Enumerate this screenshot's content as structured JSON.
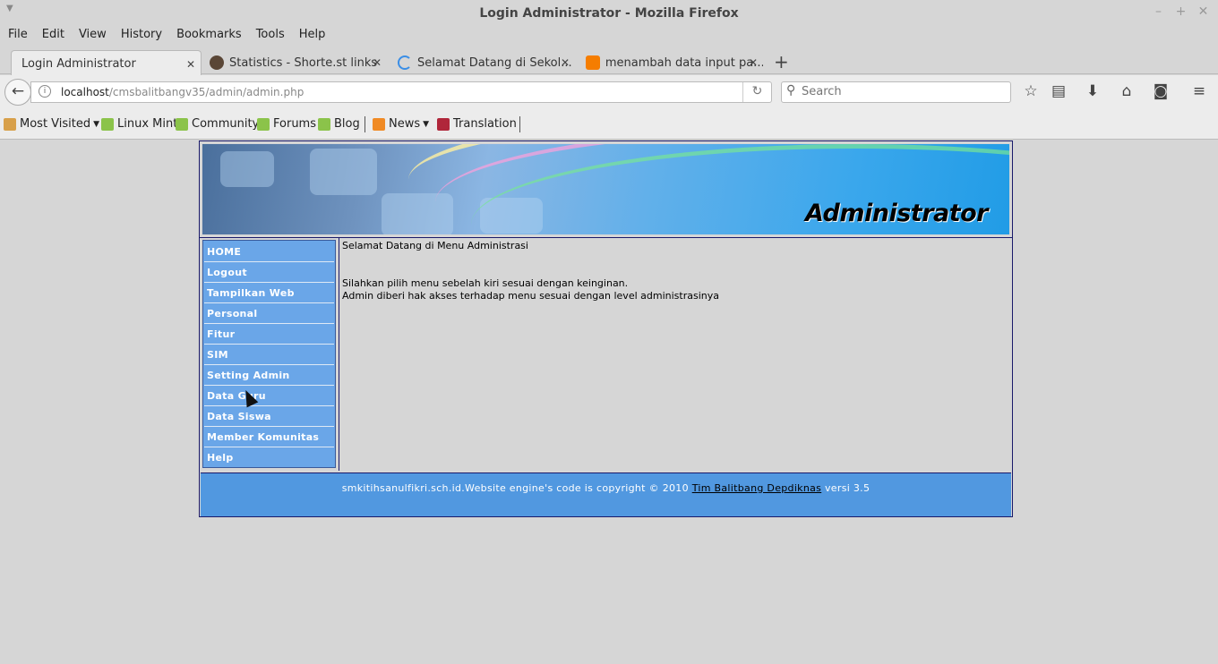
{
  "window": {
    "title": "Login Administrator - Mozilla Firefox"
  },
  "menu": [
    "File",
    "Edit",
    "View",
    "History",
    "Bookmarks",
    "Tools",
    "Help"
  ],
  "tabs": [
    {
      "label": "Login Administrator",
      "active": true
    },
    {
      "label": "Statistics - Shorte.st links",
      "active": false
    },
    {
      "label": "Selamat Datang di Sekol...",
      "active": false
    },
    {
      "label": "menambah data input pa...",
      "active": false
    }
  ],
  "nav": {
    "url_host": "localhost",
    "url_path": "/cmsbalitbangv35/admin/admin.php",
    "search_placeholder": "Search"
  },
  "bookmarks": [
    {
      "label": "Most Visited",
      "dropdown": true,
      "icon": "folder-icon"
    },
    {
      "label": "Linux Mint",
      "icon": "mint-icon"
    },
    {
      "label": "Community",
      "icon": "mint-icon"
    },
    {
      "label": "Forums",
      "icon": "mint-icon"
    },
    {
      "label": "Blog",
      "icon": "mint-icon"
    },
    {
      "label": "News",
      "dropdown": true,
      "icon": "rss-icon"
    },
    {
      "label": "Translation",
      "icon": "translation-icon"
    }
  ],
  "banner": {
    "title": "Administrator"
  },
  "sidebar": {
    "items": [
      "HOME",
      "Logout",
      "Tampilkan Web",
      "Personal",
      "Fitur",
      "SIM",
      "Setting Admin",
      "Data Guru",
      "Data Siswa",
      "Member Komunitas",
      "Help"
    ]
  },
  "content": {
    "welcome": "Selamat Datang di Menu Administrasi",
    "line1": "Silahkan pilih menu sebelah kiri sesuai dengan keinginan.",
    "line2": "Admin diberi hak akses terhadap menu sesuai dengan level administrasinya"
  },
  "footer": {
    "text_before": "smkitihsanulfikri.sch.id.Website engine's code is copyright © 2010 ",
    "link": "Tim Balitbang Depdiknas",
    "text_after": " versi 3.5"
  },
  "colors": {
    "sidebar": "#6aa6e8",
    "footer": "#5198e0",
    "border": "#1a1a6a"
  }
}
